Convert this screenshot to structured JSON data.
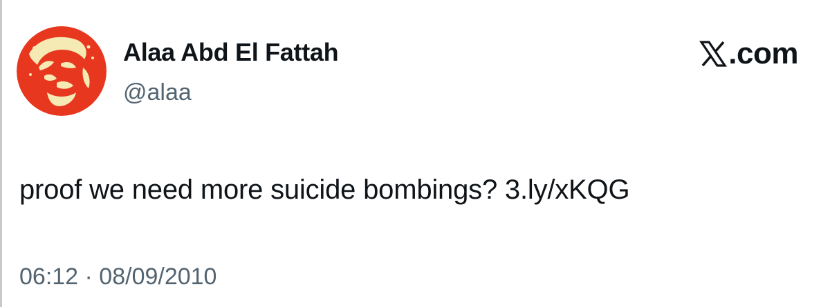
{
  "tweet": {
    "author": {
      "display_name": "Alaa Abd El Fattah",
      "handle": "@alaa"
    },
    "brand": {
      "label": ".com",
      "icon": "x-logo-icon"
    },
    "text": "proof we need more suicide bombings? 3.ly/xKQG",
    "timestamp": "06:12 · 08/09/2010"
  },
  "colors": {
    "avatar_background": "#e8371f",
    "avatar_figure": "#f5e9b4",
    "secondary_text": "#536471",
    "primary_text": "#0f1419"
  }
}
